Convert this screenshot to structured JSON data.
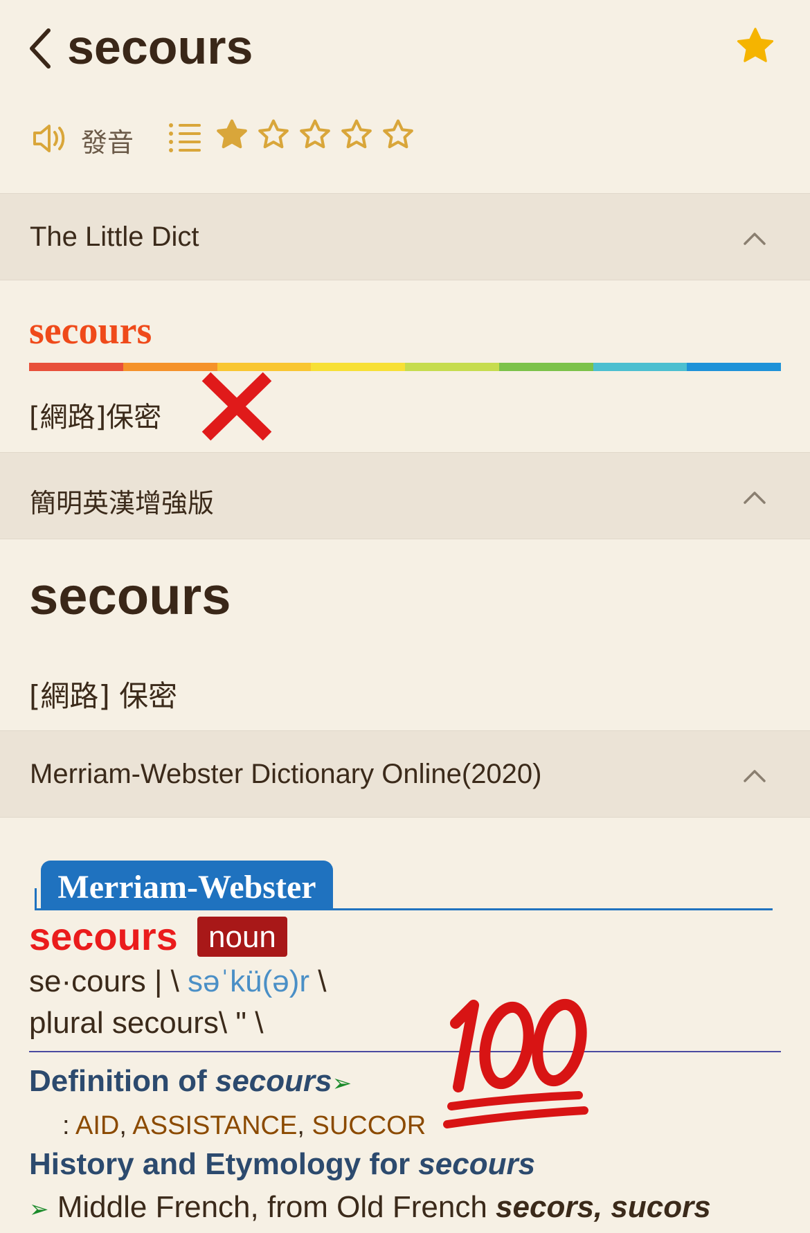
{
  "header": {
    "title": "secours",
    "pronounce_label": "發音",
    "rating": 1,
    "rating_max": 5
  },
  "sections": [
    {
      "title": "The Little Dict"
    },
    {
      "title": "簡明英漢增強版"
    },
    {
      "title": "Merriam-Webster Dictionary Online(2020)"
    }
  ],
  "little_dict": {
    "word": "secours",
    "definition": "[網路]保密",
    "rainbow_colors": [
      "#e8503a",
      "#f5922a",
      "#f9c631",
      "#f7e035",
      "#c6dc4e",
      "#7cc24a",
      "#4cbfd0",
      "#1e92d8"
    ]
  },
  "jianming": {
    "word": "secours",
    "definition": "[網路] 保密"
  },
  "merriam_webster": {
    "brand": "Merriam-Webster",
    "word": "secours",
    "pos": "noun",
    "syllables": "se·cours | \\ ",
    "ipa": "səˈkü(ə)r",
    "pron_end": " \\",
    "plural": "plural secours\\ \" \\",
    "def_head_prefix": "Definition of ",
    "def_head_word": "secours",
    "arrow": "➢",
    "syn_colon": ": ",
    "syn1": "AID",
    "syn2": "ASSISTANCE",
    "syn3": "SUCCOR",
    "sep": ", ",
    "ety_head_prefix": "History and Etymology for ",
    "ety_head_word": "secours",
    "ety_text": " Middle French, from Old French ",
    "ety_forms": "secors, sucors"
  },
  "colors": {
    "background": "#f6f0e4",
    "section_bg": "#ebe3d6",
    "accent_gold": "#d9a63a",
    "little_dict_word": "#ef4a1a",
    "mw_blue": "#1f72bf",
    "mw_red": "#ea1c1c"
  },
  "icons": [
    "back-chevron-icon",
    "star-filled-icon",
    "speaker-icon",
    "list-icon",
    "star-outline-icon",
    "chevron-up-icon",
    "red-x-mark-icon",
    "hundred-points-icon"
  ]
}
